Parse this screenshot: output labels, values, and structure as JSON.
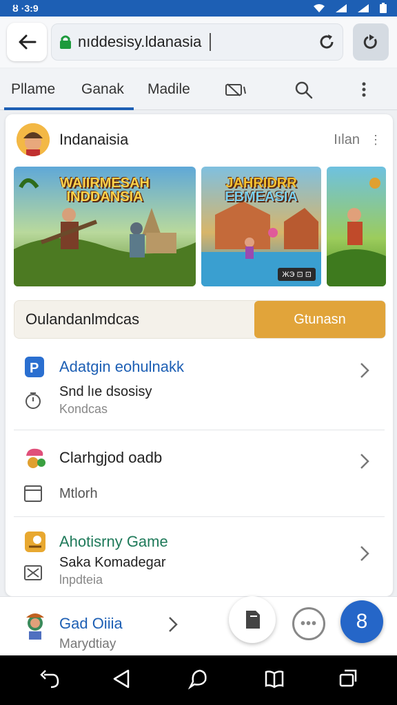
{
  "status_bar": {
    "time": "ȣ ·3:9",
    "bg_color": "#1d5fb4"
  },
  "browser": {
    "url": "nıddesisy.ldanasia"
  },
  "tabs": [
    {
      "label": "Pllame"
    },
    {
      "label": "Ganak"
    },
    {
      "label": "Madile"
    }
  ],
  "channel": {
    "name": "Indanaisia",
    "meta": "Iılan"
  },
  "thumbnails": [
    {
      "title_line1": "WAIIRMESAH",
      "title_line2": "INDDANSIA"
    },
    {
      "title_line1": "JAHRIDRR",
      "title_line2": "EBMEASIA",
      "badge": "ЖЭ ⊡ ⊡"
    },
    {
      "title_line1": ""
    }
  ],
  "search": {
    "query": "Oulandanlmdcas",
    "button_label": "Gtunasn",
    "accent_color": "#e1a43a"
  },
  "list": [
    {
      "title": "Adatgin eohulnakk",
      "sub": "Snd lıe dsosisy",
      "sub2": "Kondcas",
      "title_color": "#1d5fb4"
    },
    {
      "title": "Clarhgjod oadb",
      "sub": "Mtlorh",
      "title_color": "#222222"
    },
    {
      "title": "Ahotisrny Game",
      "sub": "Saka Komadegar",
      "sub2": "lnpdteia",
      "title_color": "#1f7a5a"
    }
  ],
  "bottom_panel": {
    "title": "Gad Oiiia",
    "sub": "Marydtiay"
  },
  "fab": {
    "label": "8",
    "color": "#2566c8"
  }
}
